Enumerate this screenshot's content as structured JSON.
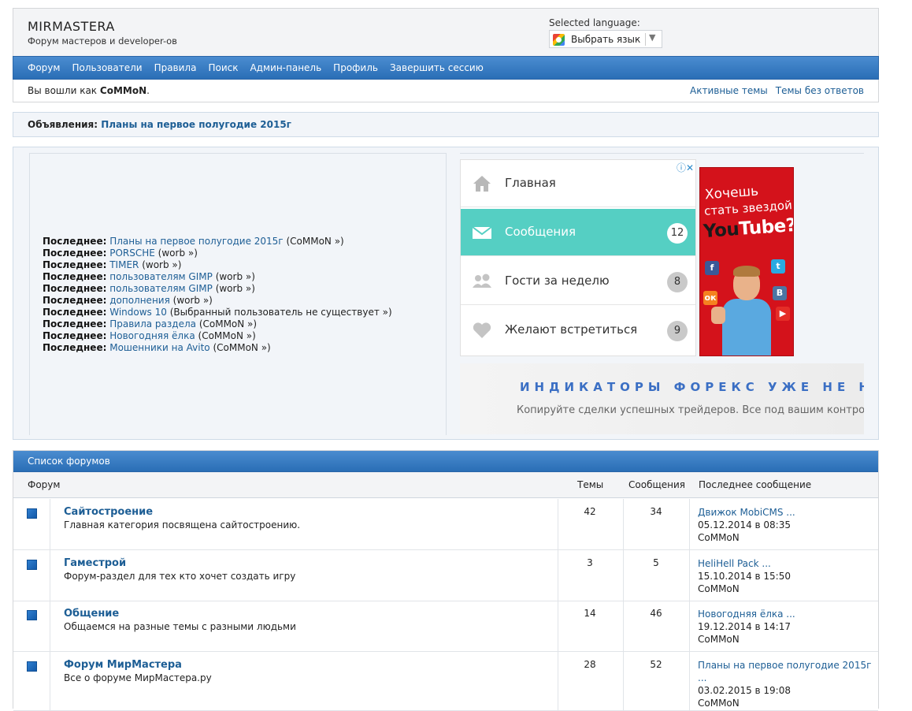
{
  "header": {
    "site_title": "MIRMASTERA",
    "site_subtitle": "Форум мастеров и developer-ов",
    "language_label": "Selected language:",
    "language_select": "Выбрать язык"
  },
  "nav": {
    "items": [
      "Форум",
      "Пользователи",
      "Правила",
      "Поиск",
      "Админ-панель",
      "Профиль",
      "Завершить сессию"
    ]
  },
  "status": {
    "logged_in_prefix": "Вы вошли как",
    "username": "CoMMoN",
    "logged_in_suffix": ".",
    "links": [
      "Активные темы",
      "Темы без ответов"
    ]
  },
  "announcement": {
    "label": "Объявления:",
    "link": "Планы на первое полугодие 2015г"
  },
  "latest": {
    "items": [
      {
        "label": "Последнее:",
        "title": "Планы на первое полугодие 2015г",
        "author": "(CoMMoN »)"
      },
      {
        "label": "Последнее:",
        "title": "PORSCHE",
        "author": "(worb »)"
      },
      {
        "label": "Последнее:",
        "title": "TIMER",
        "author": "(worb »)"
      },
      {
        "label": "Последнее:",
        "title": "пользователям GIMP",
        "author": "(worb »)"
      },
      {
        "label": "Последнее:",
        "title": "пользователям GIMP",
        "author": "(worb »)"
      },
      {
        "label": "Последнее:",
        "title": "дополнения",
        "author": "(worb »)"
      },
      {
        "label": "Последнее:",
        "title": "Windows 10",
        "author": "(Выбранный пользователь не существует »)"
      },
      {
        "label": "Последнее:",
        "title": "Правила раздела",
        "author": "(CoMMoN »)"
      },
      {
        "label": "Последнее:",
        "title": "Новогодняя ёлка",
        "author": "(CoMMoN »)"
      },
      {
        "label": "Последнее:",
        "title": "Мошенники на Avito",
        "author": "(CoMMoN »)"
      }
    ]
  },
  "ad_menu": {
    "rows": [
      {
        "label": "Главная",
        "icon": "home-icon",
        "badge": ""
      },
      {
        "label": "Сообщения",
        "icon": "mail-icon",
        "badge": "12"
      },
      {
        "label": "Гости за неделю",
        "icon": "people-icon",
        "badge": "8"
      },
      {
        "label": "Желают встретиться",
        "icon": "heart-icon",
        "badge": "9"
      }
    ]
  },
  "ad_youtube": {
    "line1": "Хочешь",
    "line2": "стать звездой",
    "logo_you": "You",
    "logo_tube": "Tube?"
  },
  "ad_forex": {
    "title": "ИНДИКАТОРЫ ФОРЕКС УЖЕ НЕ НУ",
    "subtitle": "Копируйте сделки успешных трейдеров. Все под вашим контро"
  },
  "forums": {
    "title": "Список форумов",
    "columns": {
      "forum": "Форум",
      "topics": "Темы",
      "posts": "Сообщения",
      "last": "Последнее сообщение"
    },
    "rows": [
      {
        "name": "Сайтостроение",
        "desc": "Главная категория посвящена сайтостроению.",
        "topics": "42",
        "posts": "34",
        "last_title": "Движок MobiCMS ...",
        "last_date": "05.12.2014 в 08:35",
        "last_author": "CoMMoN"
      },
      {
        "name": "Гаместрой",
        "desc": "Форум-раздел для тех кто хочет создать игру",
        "topics": "3",
        "posts": "5",
        "last_title": "HeliHell Pack ...",
        "last_date": "15.10.2014 в 15:50",
        "last_author": "CoMMoN"
      },
      {
        "name": "Общение",
        "desc": "Общаемся на разные темы с разными людьми",
        "topics": "14",
        "posts": "46",
        "last_title": "Новогодняя ёлка ...",
        "last_date": "19.12.2014 в 14:17",
        "last_author": "CoMMoN"
      },
      {
        "name": "Форум МирМастера",
        "desc": "Все о форуме МирМастера.ру",
        "topics": "28",
        "posts": "52",
        "last_title": "Планы на первое полугодие 2015г ...",
        "last_date": "03.02.2015 в 19:08",
        "last_author": "CoMMoN"
      }
    ]
  }
}
